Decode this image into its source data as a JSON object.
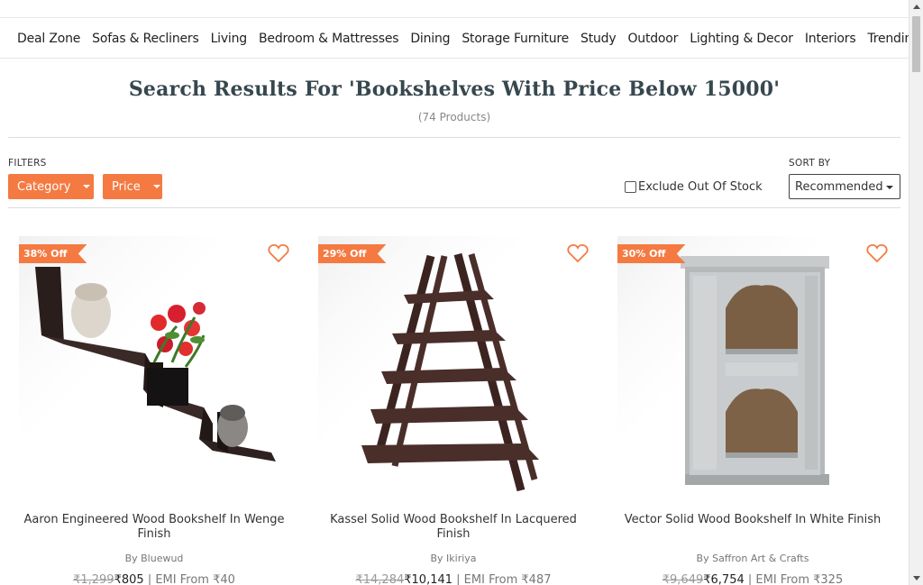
{
  "nav": {
    "items": [
      "Deal Zone",
      "Sofas & Recliners",
      "Living",
      "Bedroom & Mattresses",
      "Dining",
      "Storage Furniture",
      "Study",
      "Outdoor",
      "Lighting & Decor",
      "Interiors",
      "Trending"
    ]
  },
  "search": {
    "title": "Search Results For 'Bookshelves With Price Below 15000'",
    "count": "(74 Products)"
  },
  "filters": {
    "label": "FILTERS",
    "category": "Category",
    "price": "Price",
    "exclude_label": "Exclude Out Of Stock",
    "exclude_checked": false
  },
  "sort": {
    "label": "SORT BY",
    "selected": "Recommended"
  },
  "colors": {
    "accent": "#f47a42",
    "title": "#37474f"
  },
  "products": [
    {
      "badge": "38% Off",
      "name": "Aaron Engineered Wood Bookshelf In Wenge Finish",
      "brand": "By Bluewud",
      "mrp": "₹1,299",
      "price": "₹805",
      "emi": "| EMI From ₹40"
    },
    {
      "badge": "29% Off",
      "name": "Kassel Solid Wood Bookshelf In Lacquered Finish",
      "brand": "By Ikiriya",
      "mrp": "₹14,284",
      "price": "₹10,141",
      "emi": "| EMI From ₹487"
    },
    {
      "badge": "30% Off",
      "name": "Vector Solid Wood Bookshelf In White Finish",
      "brand": "By Saffron Art & Crafts",
      "mrp": "₹9,649",
      "price": "₹6,754",
      "emi": "| EMI From ₹325"
    }
  ],
  "icons": {
    "wishlist": "heart-outline-icon",
    "dropdown": "chevron-down-icon"
  }
}
